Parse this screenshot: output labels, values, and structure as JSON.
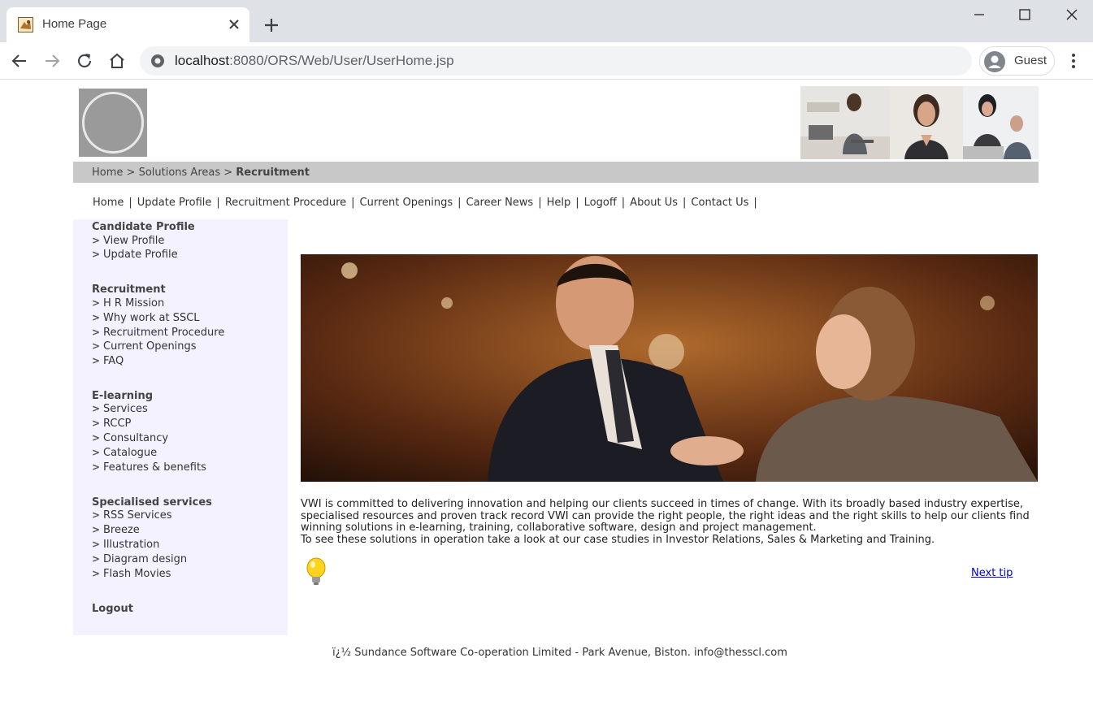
{
  "browser": {
    "tab_title": "Home Page",
    "url_host": "localhost",
    "url_rest": ":8080/ORS/Web/User/UserHome.jsp",
    "profile_label": "Guest"
  },
  "breadcrumb": {
    "home": "Home",
    "sep1": " > ",
    "section": "Solutions Areas",
    "sep2": " > ",
    "current": "Recruitment"
  },
  "topnav": [
    "Home",
    "Update Profile",
    "Recruitment Procedure",
    "Current Openings",
    "Career News",
    "Help",
    "Logoff",
    "About Us",
    "Contact Us"
  ],
  "topnav_separator": "|",
  "sidebar": {
    "arrow": ">",
    "groups": [
      {
        "title": "Candidate Profile",
        "links": [
          "View Profile",
          "Update Profile"
        ]
      },
      {
        "title": "Recruitment",
        "links": [
          "H R Mission",
          "Why work at SSCL",
          "Recruitment Procedure",
          "Current Openings",
          "FAQ"
        ]
      },
      {
        "title": "E-learning",
        "links": [
          "Services",
          "RCCP",
          "Consultancy",
          "Catalogue",
          "Features & benefits"
        ]
      },
      {
        "title": "Specialised services",
        "links": [
          "RSS Services",
          "Breeze",
          "Illustration",
          "Diagram design",
          "Flash Movies"
        ]
      }
    ],
    "logout": "Logout"
  },
  "content": {
    "paragraph1": "VWI is committed to delivering innovation and helping our clients succeed in times of change. With its broadly based industry expertise, specialised resources and proven track record VWI can provide the right people, the right ideas and the right skills to help our clients find winning solutions in e-learning, training, collaborative software, design and project management.",
    "paragraph2": "To see these solutions in operation take a look at our case studies in Investor Relations, Sales & Marketing and Training.",
    "next_tip": "Next tip"
  },
  "footer": "ï¿½ Sundance Software Co-operation Limited - Park Avenue, Biston. info@thesscl.com"
}
